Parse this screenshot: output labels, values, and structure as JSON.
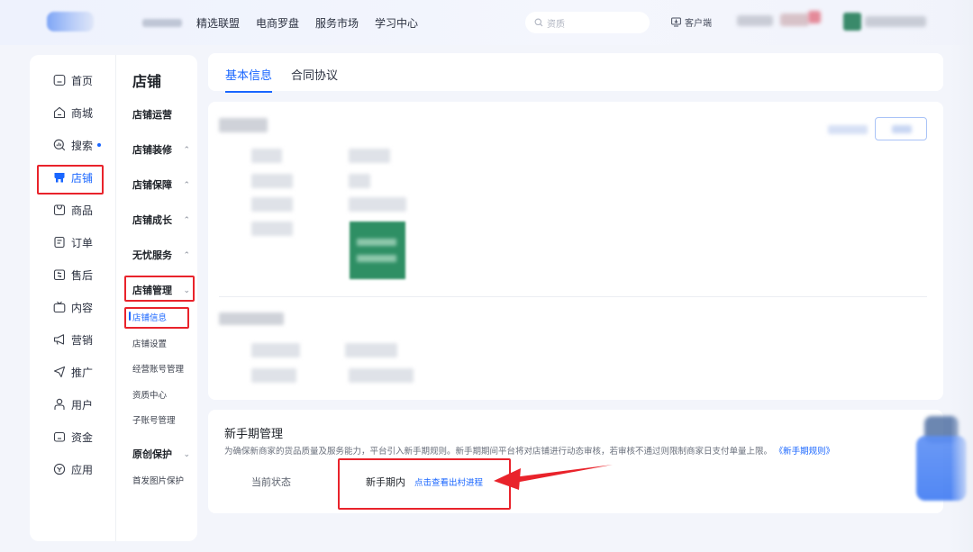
{
  "topbar": {
    "nav_items": [
      "精选联盟",
      "电商罗盘",
      "服务市场",
      "学习中心"
    ],
    "search_placeholder": "资质",
    "client_label": "客户端"
  },
  "sidebar": {
    "items": [
      {
        "label": "首页",
        "icon": "home-icon"
      },
      {
        "label": "商城",
        "icon": "mall-icon"
      },
      {
        "label": "搜索",
        "icon": "search-chart-icon"
      },
      {
        "label": "店铺",
        "icon": "shop-icon"
      },
      {
        "label": "商品",
        "icon": "product-icon"
      },
      {
        "label": "订单",
        "icon": "order-icon"
      },
      {
        "label": "售后",
        "icon": "after-sale-icon"
      },
      {
        "label": "内容",
        "icon": "tv-icon"
      },
      {
        "label": "营销",
        "icon": "megaphone-icon"
      },
      {
        "label": "推广",
        "icon": "promote-icon"
      },
      {
        "label": "用户",
        "icon": "user-icon"
      },
      {
        "label": "资金",
        "icon": "wallet-icon"
      },
      {
        "label": "应用",
        "icon": "app-icon"
      }
    ],
    "active_index": 3
  },
  "subnav": {
    "title": "店铺",
    "groups": [
      {
        "label": "店铺运营",
        "chevron": ""
      },
      {
        "label": "店铺装修",
        "chevron": "^"
      },
      {
        "label": "店铺保障",
        "chevron": "^"
      },
      {
        "label": "店铺成长",
        "chevron": "^"
      },
      {
        "label": "无忧服务",
        "chevron": "^"
      },
      {
        "label": "店铺管理",
        "chevron": "v"
      }
    ],
    "subitems": [
      "店铺信息",
      "店铺设置",
      "经营账号管理",
      "资质中心",
      "子账号管理"
    ],
    "active_subitem": "店铺信息",
    "group_original": {
      "label": "原创保护",
      "chevron": "v"
    },
    "sub_original": "首发图片保护"
  },
  "tabs": [
    {
      "label": "基本信息",
      "active": true
    },
    {
      "label": "合同协议",
      "active": false
    }
  ],
  "newcomer": {
    "title": "新手期管理",
    "description": "为确保新商家的货品质量及服务能力，平台引入新手期规则。新手期期间平台将对店铺进行动态审核，若审核不通过则限制商家日支付单量上限。",
    "rules_link": "《新手期规则》",
    "status_label": "当前状态",
    "status_value": "新手期内",
    "status_link": "点击查看出村进程"
  },
  "colors": {
    "accent": "#1966ff",
    "annotation": "#e9232b",
    "background": "#f3f5fb"
  }
}
